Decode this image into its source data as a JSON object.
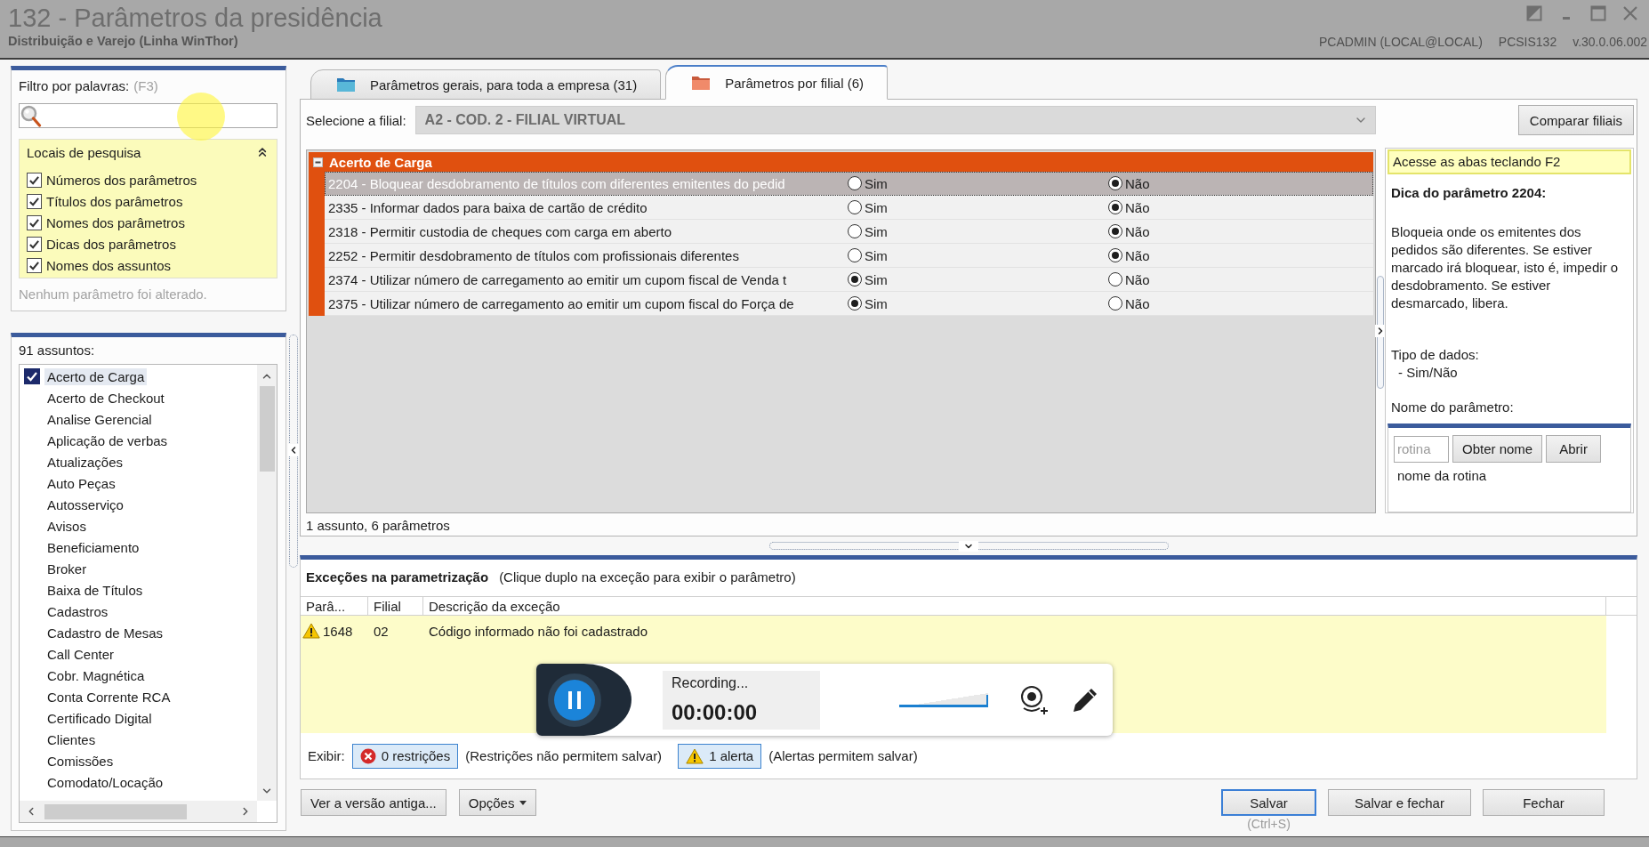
{
  "window": {
    "title": "132 - Parâmetros da presidência",
    "subtitle": "Distribuição e Varejo (Linha WinThor)",
    "user": "PCADMIN (LOCAL@LOCAL)",
    "module": "PCSIS132",
    "version": "v.30.0.06.002"
  },
  "filter": {
    "label": "Filtro por palavras:",
    "shortcut": "(F3)"
  },
  "search_locations": {
    "title": "Locais de pesquisa",
    "expanded": true,
    "options": [
      {
        "label": "Números dos parâmetros",
        "checked": true
      },
      {
        "label": "Títulos dos parâmetros",
        "checked": true
      },
      {
        "label": "Nomes dos parâmetros",
        "checked": true
      },
      {
        "label": "Dicas dos parâmetros",
        "checked": true
      },
      {
        "label": "Nomes dos assuntos",
        "checked": true
      }
    ]
  },
  "changes_note": "Nenhum parâmetro foi alterado.",
  "subjects": {
    "count_label": "91 assuntos:",
    "items": [
      {
        "label": "Acerto de Carga",
        "checked": true,
        "selected": true
      },
      {
        "label": "Acerto de Checkout",
        "checked": false,
        "selected": false
      },
      {
        "label": "Analise Gerencial",
        "checked": false,
        "selected": false
      },
      {
        "label": "Aplicação de verbas",
        "checked": false,
        "selected": false
      },
      {
        "label": "Atualizações",
        "checked": false,
        "selected": false
      },
      {
        "label": "Auto Peças",
        "checked": false,
        "selected": false
      },
      {
        "label": "Autosserviço",
        "checked": false,
        "selected": false
      },
      {
        "label": "Avisos",
        "checked": false,
        "selected": false
      },
      {
        "label": "Beneficiamento",
        "checked": false,
        "selected": false
      },
      {
        "label": "Broker",
        "checked": false,
        "selected": false
      },
      {
        "label": "Baixa de Títulos",
        "checked": false,
        "selected": false
      },
      {
        "label": "Cadastros",
        "checked": false,
        "selected": false
      },
      {
        "label": "Cadastro de Mesas",
        "checked": false,
        "selected": false
      },
      {
        "label": "Call Center",
        "checked": false,
        "selected": false
      },
      {
        "label": "Cobr. Magnética",
        "checked": false,
        "selected": false
      },
      {
        "label": "Conta Corrente RCA",
        "checked": false,
        "selected": false
      },
      {
        "label": "Certificado Digital",
        "checked": false,
        "selected": false
      },
      {
        "label": "Clientes",
        "checked": false,
        "selected": false
      },
      {
        "label": "Comissões",
        "checked": false,
        "selected": false
      },
      {
        "label": "Comodato/Locação",
        "checked": false,
        "selected": false
      }
    ]
  },
  "tabs": [
    {
      "label": "Parâmetros gerais, para toda a empresa (31)",
      "selected": false
    },
    {
      "label": "Parâmetros por filial (6)",
      "selected": true
    }
  ],
  "branch": {
    "label": "Selecione a filial:",
    "value": "A2 - COD. 2 - FILIAL VIRTUAL",
    "disabled": true
  },
  "compare_button": "Comparar filiais",
  "parameters": {
    "group": "Acerto de Carga",
    "expanded": true,
    "rows": [
      {
        "label": "2204 - Bloquear desdobramento de títulos com diferentes emitentes do pedid",
        "selected": true,
        "options": [
          {
            "label": "Sim",
            "selected": false
          },
          {
            "label": "Não",
            "selected": true
          }
        ]
      },
      {
        "label": "2335 - Informar dados para baixa de cartão de crédito",
        "selected": false,
        "options": [
          {
            "label": "Sim",
            "selected": false
          },
          {
            "label": "Não",
            "selected": true
          }
        ]
      },
      {
        "label": "2318 - Permitir custodia de cheques com carga em aberto",
        "selected": false,
        "options": [
          {
            "label": "Sim",
            "selected": false
          },
          {
            "label": "Não",
            "selected": true
          }
        ]
      },
      {
        "label": "2252 - Permitir desdobramento de títulos com profissionais diferentes",
        "selected": false,
        "options": [
          {
            "label": "Sim",
            "selected": false
          },
          {
            "label": "Não",
            "selected": true
          }
        ]
      },
      {
        "label": "2374 - Utilizar número de carregamento ao emitir um cupom fiscal de Venda t",
        "selected": false,
        "options": [
          {
            "label": "Sim",
            "selected": true
          },
          {
            "label": "Não",
            "selected": false
          }
        ]
      },
      {
        "label": "2375 - Utilizar número de carregamento ao emitir um cupom fiscal do Força de",
        "selected": false,
        "options": [
          {
            "label": "Sim",
            "selected": true
          },
          {
            "label": "Não",
            "selected": false
          }
        ]
      }
    ]
  },
  "status": "1 assunto, 6 parâmetros",
  "help": {
    "hint": "Acesse as abas teclando F2",
    "title": "Dica do parâmetro 2204:",
    "text": "Bloqueia onde os emitentes dos pedidos são diferentes. Se estiver marcado irá bloquear, isto é, impedir o desdobramento. Se estiver desmarcado, libera.",
    "type_label": "Tipo de dados:",
    "type_value": "- Sim/Não",
    "name_label": "Nome do parâmetro:",
    "routine": {
      "placeholder": "rotina"
    },
    "buttons": [
      "Obter nome",
      "Abrir"
    ],
    "routine_name": "nome da rotina"
  },
  "exceptions": {
    "title": "Exceções na parametrização",
    "hint": "(Clique duplo na exceção para exibir o parâmetro)",
    "columns": [
      "Parâ...",
      "Filial",
      "Descrição da exceção"
    ],
    "rows": [
      {
        "kind": "warning",
        "cells": [
          "1648",
          "02",
          "Código informado não foi cadastrado"
        ]
      }
    ]
  },
  "filter_bar": {
    "label": "Exibir:",
    "toggles": [
      {
        "kind": "error",
        "label": "0 restrições",
        "pressed": true,
        "note": "(Restrições não permitem salvar)"
      },
      {
        "kind": "warning",
        "label": "1 alerta",
        "pressed": true,
        "note": "(Alertas permitem salvar)"
      }
    ]
  },
  "buttons_left": [
    {
      "label": "Ver a versão antiga...",
      "dropdown": false
    },
    {
      "label": "Opções",
      "dropdown": true
    }
  ],
  "buttons_right": [
    {
      "label": "Salvar",
      "default": true,
      "shortcut": "(Ctrl+S)"
    },
    {
      "label": "Salvar e fechar",
      "default": false
    },
    {
      "label": "Fechar",
      "default": false
    }
  ],
  "recorder": {
    "status": "Recording...",
    "time": "00:00:00",
    "volume": {
      "level": 1
    }
  }
}
